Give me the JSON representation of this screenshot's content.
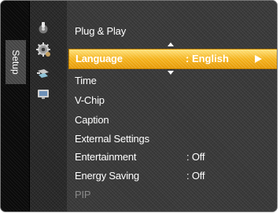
{
  "sidebar": {
    "title": "Setup",
    "icons": [
      "picture-category-icon",
      "setup-gear-icon",
      "input-category-icon",
      "application-category-icon"
    ]
  },
  "menu": {
    "items": [
      {
        "label": "Plug & Play",
        "value": "",
        "state": "normal"
      },
      {
        "label": "Language",
        "value": ": English",
        "state": "selected"
      },
      {
        "label": "Time",
        "value": "",
        "state": "normal"
      },
      {
        "label": "V-Chip",
        "value": "",
        "state": "normal"
      },
      {
        "label": "Caption",
        "value": "",
        "state": "normal"
      },
      {
        "label": "External Settings",
        "value": "",
        "state": "normal"
      },
      {
        "label": "Entertainment",
        "value": ": Off",
        "state": "normal"
      },
      {
        "label": "Energy Saving",
        "value": ": Off",
        "state": "normal"
      },
      {
        "label": "PIP",
        "value": "",
        "state": "disabled"
      }
    ]
  },
  "colors": {
    "highlight": "#f4b21a",
    "text": "#ffffff",
    "disabled_text": "#8a8a8a"
  }
}
